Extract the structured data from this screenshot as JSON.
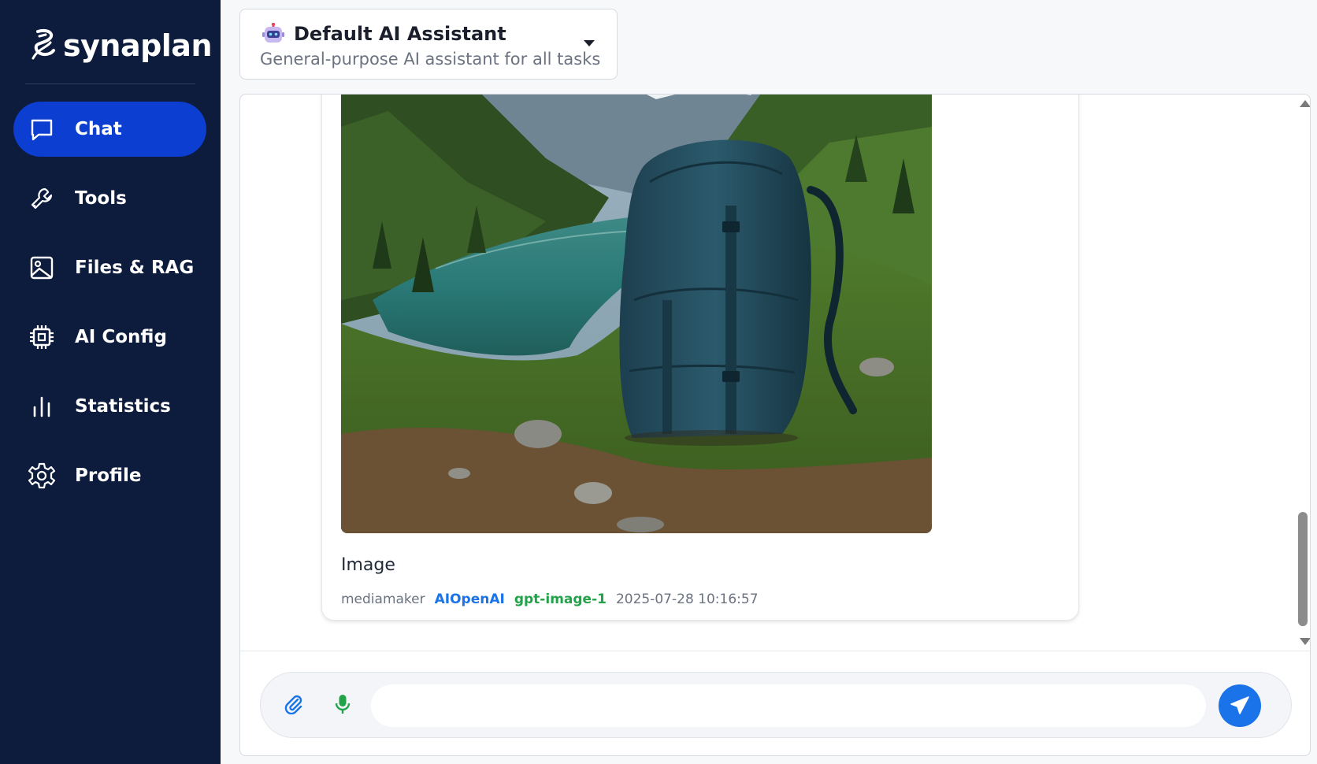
{
  "brand": {
    "name": "synaplan"
  },
  "sidebar": {
    "items": [
      {
        "label": "Chat",
        "icon": "chat-bubble-icon",
        "active": true
      },
      {
        "label": "Tools",
        "icon": "wrench-icon",
        "active": false
      },
      {
        "label": "Files & RAG",
        "icon": "image-file-icon",
        "active": false
      },
      {
        "label": "AI Config",
        "icon": "chip-icon",
        "active": false
      },
      {
        "label": "Statistics",
        "icon": "bar-chart-icon",
        "active": false
      },
      {
        "label": "Profile",
        "icon": "gear-icon",
        "active": false
      }
    ]
  },
  "assistant": {
    "icon": "robot-icon",
    "title": "Default AI Assistant",
    "subtitle": "General-purpose AI assistant for all tasks"
  },
  "message": {
    "image_description": "generated image: blue hiking backpack on a grassy slope beside an alpine lake",
    "text": "Image",
    "meta": {
      "user": "mediamaker",
      "provider": "AIOpenAI",
      "model": "gpt-image-1",
      "timestamp": "2025-07-28 10:16:57"
    }
  },
  "composer": {
    "placeholder": "",
    "value": ""
  },
  "colors": {
    "sidebar_bg": "#0d1b3d",
    "active_nav": "#0c3fd1",
    "provider": "#1a73e8",
    "model": "#22a34a",
    "send_button": "#1a73e8"
  }
}
